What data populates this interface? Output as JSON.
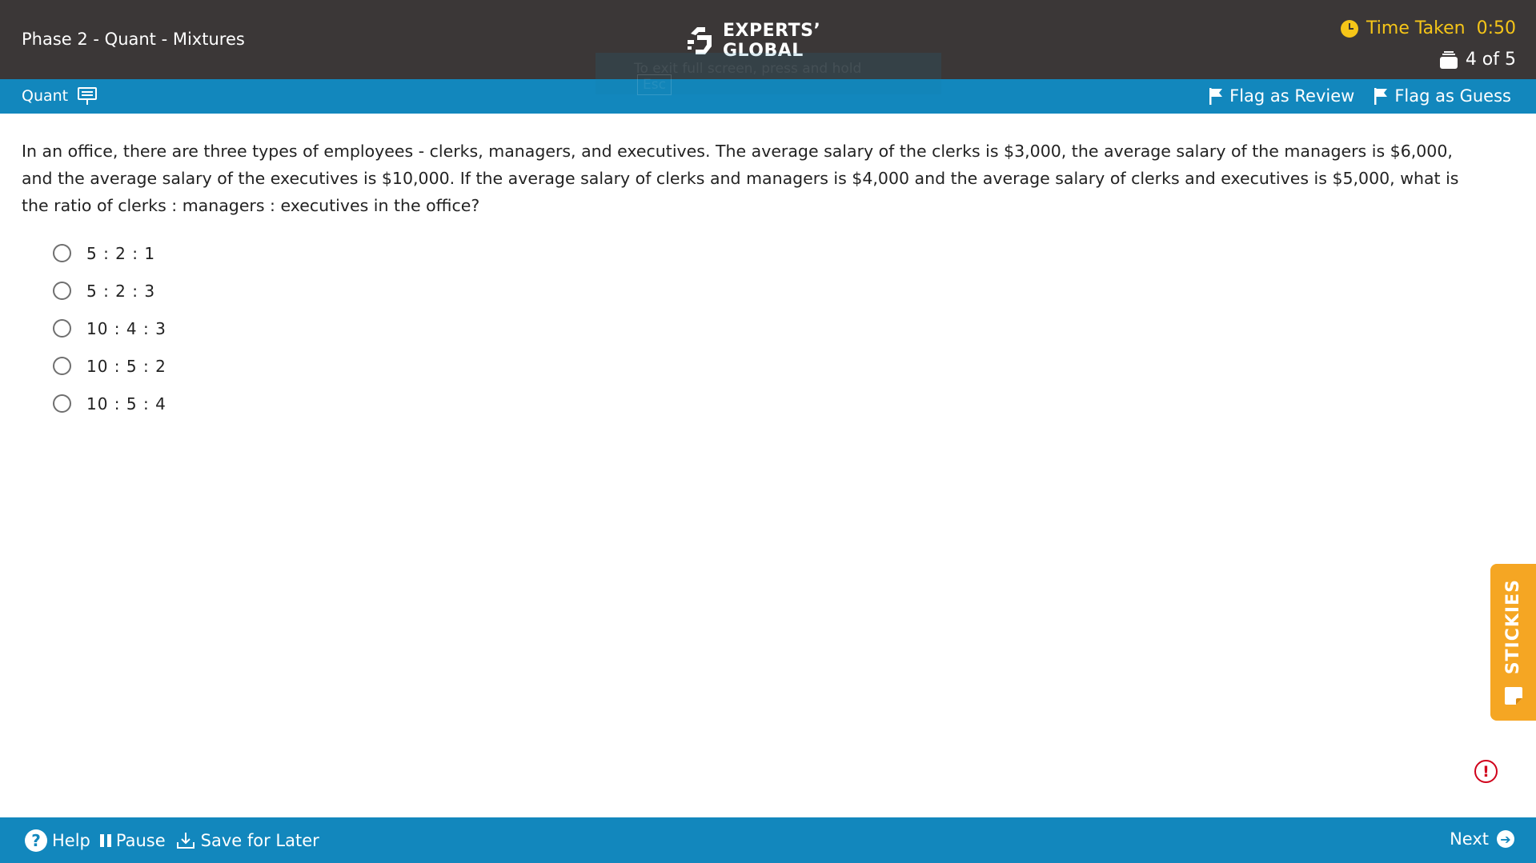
{
  "header": {
    "section_title": "Phase 2 - Quant - Mixtures",
    "logo_line1": "EXPERTS’",
    "logo_line2": "GLOBAL",
    "exit_hint": "To exit full screen, press and hold",
    "exit_key": "Esc",
    "timer_label": "Time Taken",
    "timer_value": "0:50",
    "progress": "4 of 5",
    "timer_color": "#f5c518"
  },
  "subbar": {
    "subject": "Quant",
    "flag_review": "Flag as Review",
    "flag_guess": "Flag as Guess"
  },
  "question": {
    "text": "In an office, there are three types of employees - clerks, managers, and executives. The average salary of the clerks is $3,000, the average salary of the managers is $6,000, and the average salary of the executives is $10,000. If the average salary of clerks and managers is $4,000 and the average salary of clerks and executives is $5,000, what is the ratio of clerks : managers : executives in the office?",
    "options": [
      "5 : 2 : 1",
      "5 : 2 : 3",
      "10 : 4 : 3",
      "10 : 5 : 2",
      "10 : 5 : 4"
    ]
  },
  "stickies": {
    "label": "STICKIES",
    "color": "#f5a623"
  },
  "alert": {
    "glyph": "!"
  },
  "footer": {
    "help_glyph": "?",
    "help": "Help",
    "pause": "Pause",
    "save_later": "Save for Later",
    "next": "Next",
    "accent": "#1287bd"
  },
  "icons": [
    "clock-icon",
    "stack-icon",
    "whiteboard-icon",
    "flag-icon",
    "sticky-note-icon",
    "alert-icon",
    "help-icon",
    "pause-icon",
    "download-icon",
    "arrow-right-icon"
  ]
}
